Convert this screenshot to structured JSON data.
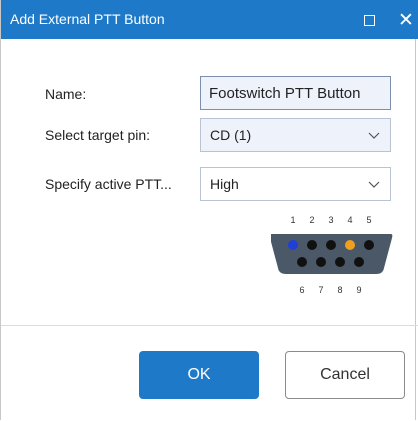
{
  "window": {
    "title": "Add External PTT Button",
    "maximize_icon": "maximize-icon",
    "close_icon": "close-icon",
    "close_glyph": "✕"
  },
  "form": {
    "name_label": "Name:",
    "name_value": "Footswitch PTT Button",
    "pin_label": "Select target pin:",
    "pin_value": "CD (1)",
    "active_label": "Specify active PTT...",
    "active_value": "High"
  },
  "connector": {
    "top_pins": [
      "1",
      "2",
      "3",
      "4",
      "5"
    ],
    "bottom_pins": [
      "6",
      "7",
      "8",
      "9"
    ],
    "selected_pin": "1",
    "selected_color": "#1f3fd6",
    "highlight_pin": "4",
    "highlight_color": "#f0a01e",
    "pin_color": "#111111",
    "shell_color": "#4a5868"
  },
  "buttons": {
    "ok_label": "OK",
    "cancel_label": "Cancel"
  },
  "colors": {
    "accent": "#1e7ac8"
  }
}
